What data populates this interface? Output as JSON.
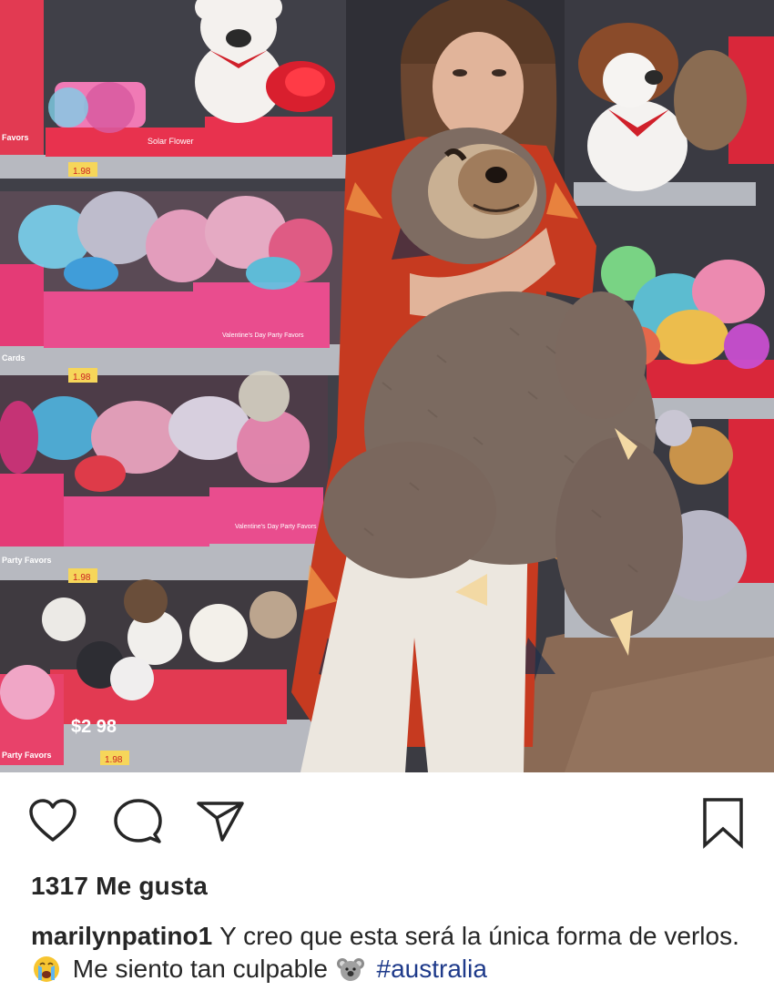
{
  "post": {
    "likes_text": "1317 Me gusta",
    "username": "marilynpatino1",
    "caption_part1": "Y creo que esta será la única forma de verlos.",
    "caption_part2": "Me siento tan culpable",
    "hashtag": "#australia",
    "emoji_1": "crying-face",
    "emoji_2": "koala-face"
  },
  "photo": {
    "shelf_labels": {
      "favors_top": "Favors",
      "solar_flower": "Solar Flower",
      "cards": "Cards",
      "valentines_party_favors_1": "Valentine's Day Party Favors",
      "valentines_party_favors_2": "Valentine's Day Party Favors",
      "party_favors_1": "Party Favors",
      "party_favors_2": "Party Favors"
    },
    "price_tags": [
      "1.98",
      "1.98",
      "1.98",
      "1.98"
    ],
    "big_price": "$2 98"
  },
  "icons": {
    "like": "heart-icon",
    "comment": "comment-icon",
    "share": "paper-plane-icon",
    "save": "bookmark-icon"
  }
}
